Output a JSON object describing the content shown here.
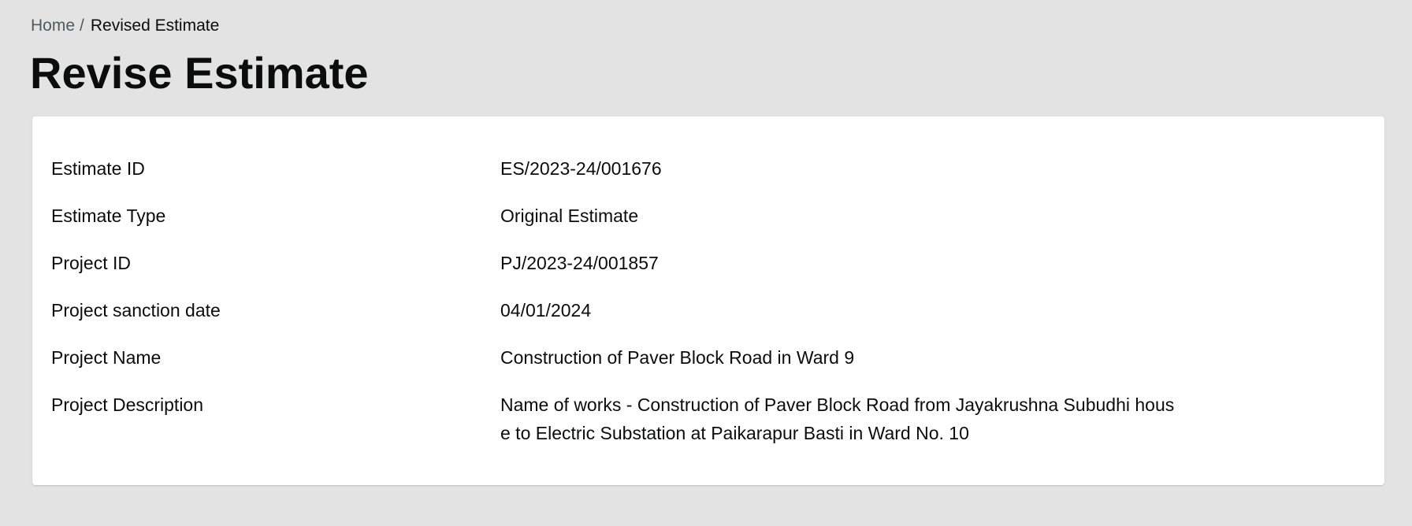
{
  "breadcrumb": {
    "home": "Home",
    "separator": "/",
    "current": "Revised Estimate"
  },
  "page": {
    "title": "Revise Estimate"
  },
  "details": [
    {
      "label": "Estimate ID",
      "value": "ES/2023-24/001676"
    },
    {
      "label": "Estimate Type",
      "value": "Original Estimate"
    },
    {
      "label": "Project ID",
      "value": "PJ/2023-24/001857"
    },
    {
      "label": "Project sanction date",
      "value": "04/01/2024"
    },
    {
      "label": "Project Name",
      "value": "Construction of Paver Block Road in Ward 9"
    },
    {
      "label": "Project Description",
      "value": "Name of works - Construction of Paver Block Road from Jayakrushna Subudhi house to Electric Substation at Paikarapur Basti in Ward No. 10"
    }
  ],
  "colors": {
    "background": "#e3e3e3",
    "card": "#ffffff",
    "text": "#0b0c0c",
    "breadcrumb_link": "#505a5f"
  }
}
